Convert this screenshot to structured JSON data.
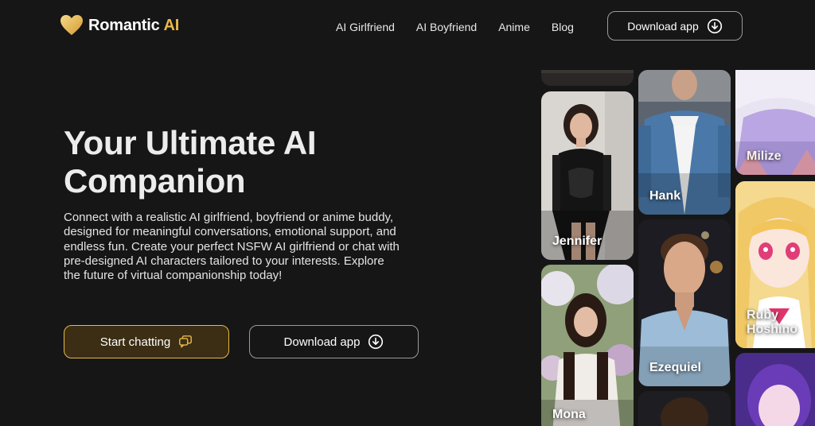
{
  "brand": {
    "name_main": "Romantic",
    "name_accent": "AI",
    "accent_color": "#e8b84a"
  },
  "nav": {
    "items": [
      {
        "label": "AI Girlfriend"
      },
      {
        "label": "AI Boyfriend"
      },
      {
        "label": "Anime"
      },
      {
        "label": "Blog"
      }
    ],
    "download_label": "Download app"
  },
  "hero": {
    "title": "Your Ultimate AI Companion",
    "description": "Connect with a realistic AI girlfriend, boyfriend or anime buddy, designed for meaningful conversations, emotional support, and endless fun. Create your perfect NSFW AI girlfriend or chat with pre-designed AI characters tailored to your interests. Explore the future of virtual companionship today!",
    "primary_label": "Start chatting",
    "secondary_label": "Download app"
  },
  "characters": [
    {
      "name": "Jennifer"
    },
    {
      "name": "Mona"
    },
    {
      "name": "Hank"
    },
    {
      "name": "Ezequiel"
    },
    {
      "name": "Milize"
    },
    {
      "name": "Ruby Hoshino"
    }
  ],
  "icons": {
    "logo": "heart-icon",
    "download": "download-icon",
    "chat": "chat-bubbles-icon"
  }
}
